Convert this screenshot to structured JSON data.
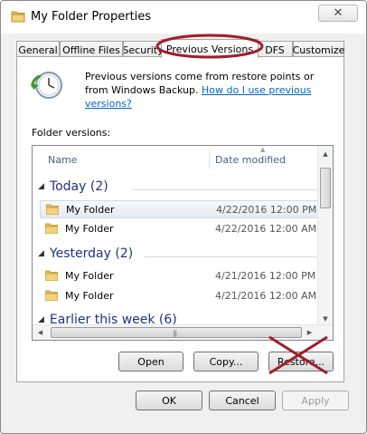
{
  "window": {
    "title": "My Folder Properties",
    "close_symbol": "✕"
  },
  "tabs": [
    {
      "label": "General"
    },
    {
      "label": "Offline Files"
    },
    {
      "label": "Security"
    },
    {
      "label": "Previous Versions"
    },
    {
      "label": "DFS"
    },
    {
      "label": "Customize"
    }
  ],
  "info": {
    "text": "Previous versions come from restore points or from Windows Backup.",
    "link": "How do I use previous versions?"
  },
  "folder_versions_label": "Folder versions:",
  "columns": {
    "name": "Name",
    "date": "Date modified"
  },
  "groups": [
    {
      "label": "Today (2)",
      "items": [
        {
          "name": "My Folder",
          "date": "4/22/2016 12:00 PM"
        },
        {
          "name": "My Folder",
          "date": "4/22/2016 12:00 AM"
        }
      ]
    },
    {
      "label": "Yesterday (2)",
      "items": [
        {
          "name": "My Folder",
          "date": "4/21/2016 12:00 PM"
        },
        {
          "name": "My Folder",
          "date": "4/21/2016 12:00 AM"
        }
      ]
    },
    {
      "label": "Earlier this week (6)",
      "items": []
    }
  ],
  "actions": {
    "open": "Open",
    "copy": "Copy...",
    "restore": "Restore..."
  },
  "footer": {
    "ok": "OK",
    "cancel": "Cancel",
    "apply": "Apply"
  },
  "colors": {
    "accent_group": "#1e3287",
    "link": "#0066cc",
    "annotation": "#a11d2b"
  }
}
